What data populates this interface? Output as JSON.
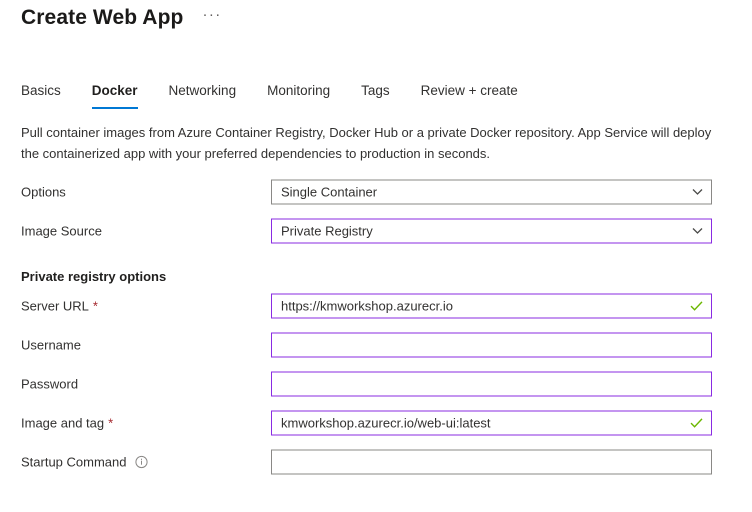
{
  "header": {
    "title": "Create Web App",
    "more_label": "···"
  },
  "tabs": [
    {
      "label": "Basics",
      "active": false
    },
    {
      "label": "Docker",
      "active": true
    },
    {
      "label": "Networking",
      "active": false
    },
    {
      "label": "Monitoring",
      "active": false
    },
    {
      "label": "Tags",
      "active": false
    },
    {
      "label": "Review + create",
      "active": false
    }
  ],
  "description": "Pull container images from Azure Container Registry, Docker Hub or a private Docker repository. App Service will deploy the containerized app with your preferred dependencies to production in seconds.",
  "sections": {
    "private_registry_heading": "Private registry options"
  },
  "fields": {
    "options": {
      "label": "Options",
      "value": "Single Container",
      "control": "dropdown",
      "border": "default",
      "icon": "chevron-down-icon"
    },
    "image_source": {
      "label": "Image Source",
      "value": "Private Registry",
      "control": "dropdown",
      "border": "modified",
      "icon": "chevron-down-icon"
    },
    "server_url": {
      "label": "Server URL",
      "required_marker": "*",
      "value": "https://kmworkshop.azurecr.io",
      "placeholder": "",
      "control": "textbox",
      "border": "modified",
      "icon": "validation-check-icon"
    },
    "username": {
      "label": "Username",
      "value": "",
      "placeholder": "",
      "control": "textbox",
      "border": "modified",
      "icon": ""
    },
    "password": {
      "label": "Password",
      "value": "",
      "placeholder": "",
      "control": "textbox",
      "border": "modified",
      "icon": ""
    },
    "image_and_tag": {
      "label": "Image and tag",
      "required_marker": "*",
      "value": "kmworkshop.azurecr.io/web-ui:latest",
      "placeholder": "",
      "control": "textbox",
      "border": "modified",
      "icon": "validation-check-icon"
    },
    "startup_command": {
      "label": "Startup Command",
      "value": "",
      "placeholder": "",
      "control": "textbox",
      "border": "default",
      "icon": "info-icon"
    }
  },
  "colors": {
    "accent_blue": "#0078d4",
    "modified_border": "#8a2be2",
    "default_border": "#8a8886",
    "required_red": "#a4262c",
    "validation_green": "#6bb700",
    "text_primary": "#323130"
  }
}
